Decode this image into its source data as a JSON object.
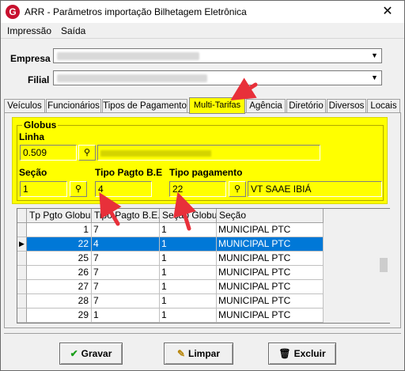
{
  "window": {
    "title": "ARR - Parâmetros importação Bilhetagem Eletrônica",
    "close_glyph": "✕",
    "app_icon_letter": "G"
  },
  "menu": {
    "items": [
      "Impressão",
      "Saída"
    ]
  },
  "header": {
    "empresa_label": "Empresa",
    "filial_label": "Filial"
  },
  "tabs": [
    {
      "label": "Veículos",
      "active": false
    },
    {
      "label": "Funcionários",
      "active": false
    },
    {
      "label": "Tipos de Pagamento",
      "active": false
    },
    {
      "label": "Multi-Tarifas",
      "active": true
    },
    {
      "label": "Agência",
      "active": false
    },
    {
      "label": "Diretório",
      "active": false
    },
    {
      "label": "Diversos",
      "active": false
    },
    {
      "label": "Locais",
      "active": false
    }
  ],
  "globus": {
    "group_title": "Globus",
    "linha_label": "Linha",
    "linha_value": "0.509",
    "secao_label": "Seção",
    "secao_value": "1",
    "tipo_pagto_be_label": "Tipo Pagto B.E",
    "tipo_pagto_be_value": "4",
    "tipo_pagamento_label": "Tipo pagamento",
    "tipo_pagamento_value": "22",
    "tipo_pagamento_desc": "VT SAAE IBIÁ",
    "lookup_icon": "binoculars-icon"
  },
  "table": {
    "columns": [
      "Tp Pgto Globus",
      "Tipo Pagto B.E.",
      "Seção Globus",
      "Seção"
    ],
    "rows": [
      [
        "1",
        "7",
        "1",
        "MUNICIPAL PTC"
      ],
      [
        "22",
        "4",
        "1",
        "MUNICIPAL PTC"
      ],
      [
        "25",
        "7",
        "1",
        "MUNICIPAL PTC"
      ],
      [
        "26",
        "7",
        "1",
        "MUNICIPAL PTC"
      ],
      [
        "27",
        "7",
        "1",
        "MUNICIPAL PTC"
      ],
      [
        "28",
        "7",
        "1",
        "MUNICIPAL PTC"
      ],
      [
        "29",
        "1",
        "1",
        "MUNICIPAL PTC"
      ]
    ],
    "selected_row": 1,
    "selection_color": "#0078d7"
  },
  "buttons": {
    "gravar": "Gravar",
    "limpar": "Limpar",
    "excluir": "Excluir"
  },
  "colors": {
    "highlight": "#ffff00",
    "annotation_arrow": "#e8303a"
  }
}
